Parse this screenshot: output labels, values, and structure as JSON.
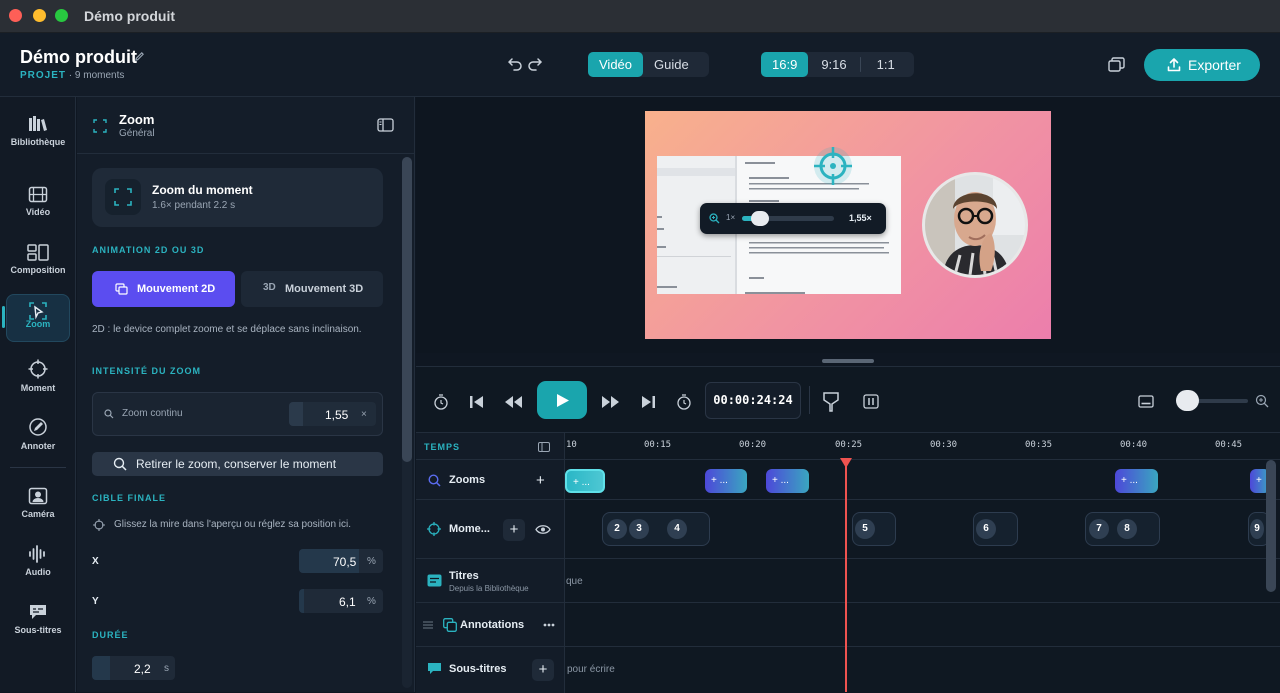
{
  "window": {
    "title": "Démo produit"
  },
  "header": {
    "project_title": "Démo produit",
    "project_tag": "PROJET",
    "project_meta": "9 moments",
    "mode_tabs": [
      {
        "label": "Vidéo",
        "active": true
      },
      {
        "label": "Guide",
        "active": false
      }
    ],
    "ratios": [
      {
        "label": "16:9",
        "active": true
      },
      {
        "label": "9:16",
        "active": false
      },
      {
        "label": "1:1",
        "active": false
      }
    ],
    "export_label": "Exporter"
  },
  "nav": {
    "items": [
      {
        "label": "Bibliothèque",
        "icon": "library-icon"
      },
      {
        "label": "Vidéo",
        "icon": "film-icon"
      },
      {
        "label": "Composition",
        "icon": "layout-icon"
      },
      {
        "label": "Zoom",
        "icon": "zoom-frame-icon",
        "active": true
      },
      {
        "label": "Moment",
        "icon": "crosshair-icon"
      },
      {
        "label": "Annoter",
        "icon": "annotate-icon"
      },
      {
        "label": "Caméra",
        "icon": "camera-icon"
      },
      {
        "label": "Audio",
        "icon": "audio-wave-icon"
      },
      {
        "label": "Sous-titres",
        "icon": "subtitles-icon"
      }
    ]
  },
  "panel": {
    "title": "Zoom",
    "subtitle": "Général",
    "card_title": "Zoom du moment",
    "card_sub": "1.6× pendant 2.2 s",
    "section_anim": "ANIMATION 2D OU 3D",
    "btn_2d": "Mouvement 2D",
    "btn_3d_tag": "3D",
    "btn_3d": "Mouvement 3D",
    "desc_2d": "2D : le device complet zoome et se déplace sans inclinaison.",
    "section_intensity": "INTENSITÉ DU ZOOM",
    "zoom_label": "Zoom continu",
    "zoom_value": "1,55",
    "zoom_clear": "×",
    "reset_label": "Retirer le zoom, conserver le moment",
    "section_target": "CIBLE FINALE",
    "target_hint": "Glissez la mire dans l'aperçu ou réglez sa position ici.",
    "x_label": "X",
    "x_value": "70,5",
    "y_label": "Y",
    "y_value": "6,1",
    "pct": "%",
    "section_duration": "DURÉE",
    "duration_value": "2,2",
    "duration_unit": "s"
  },
  "preview": {
    "zoom_min": "1×",
    "zoom_value": "1,55×",
    "zoom_level": 0.12
  },
  "transport": {
    "timecode": "00:00:24:24"
  },
  "timeline": {
    "header_label": "TEMPS",
    "ticks": [
      "10",
      "00:15",
      "00:20",
      "00:25",
      "00:30",
      "00:35",
      "00:40",
      "00:45"
    ],
    "tracks": [
      {
        "name": "Zooms"
      },
      {
        "name": "Mome..."
      },
      {
        "name": "Titres",
        "sub": "Depuis la Bibliothèque"
      },
      {
        "name": "Annotations"
      },
      {
        "name": "Sous-titres"
      }
    ],
    "zoom_clips": [
      "+ ...",
      "+ ...",
      "+ ...",
      "+ ...",
      "+"
    ],
    "moments": [
      "2",
      "3",
      "4",
      "5",
      "6",
      "7",
      "8",
      "9"
    ],
    "titres_ghost": "que",
    "subs_ghost": "pour écrire"
  },
  "colors": {
    "accent": "#1aa5ad",
    "violet": "#5b4df0",
    "playhead": "#ef5350"
  }
}
